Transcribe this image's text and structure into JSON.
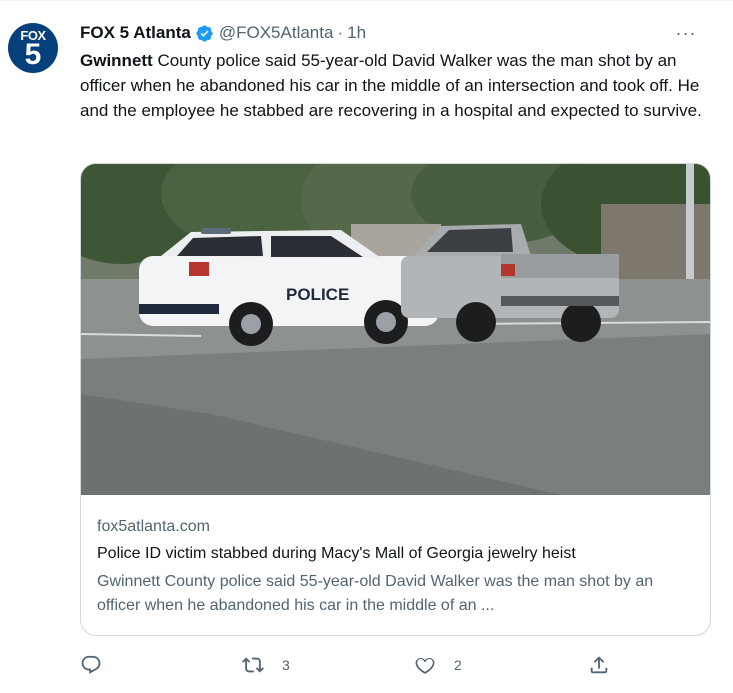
{
  "tweet": {
    "avatar_text_top": "FOX",
    "avatar_text_bottom": "5",
    "author_name": "FOX 5 Atlanta",
    "handle": "@FOX5Atlanta",
    "dot": "·",
    "time": "1h",
    "body_bold": "Gwinnett",
    "body_rest": " County police said 55-year-old David Walker was the man shot by an officer when he abandoned his car in the middle of an intersection and took off. He and the employee he stabbed are recovering in a hospital and expected to survive.",
    "more_label": "···"
  },
  "card": {
    "image_text": "POLICE",
    "domain": "fox5atlanta.com",
    "title": "Police ID victim stabbed during Macy's Mall of Georgia jewelry heist",
    "description": "Gwinnett County police said 55-year-old David Walker was the man shot by an officer when he abandoned his car in the middle of an ..."
  },
  "actions": {
    "reply_count": "",
    "retweet_count": "3",
    "like_count": "2"
  },
  "colors": {
    "accent": "#1d9bf0",
    "secondary_text": "#536471",
    "border": "#cfd9de",
    "avatar_bg": "#06407c"
  },
  "icons": [
    "verified-icon",
    "more-icon",
    "reply-icon",
    "retweet-icon",
    "like-icon",
    "share-icon"
  ]
}
